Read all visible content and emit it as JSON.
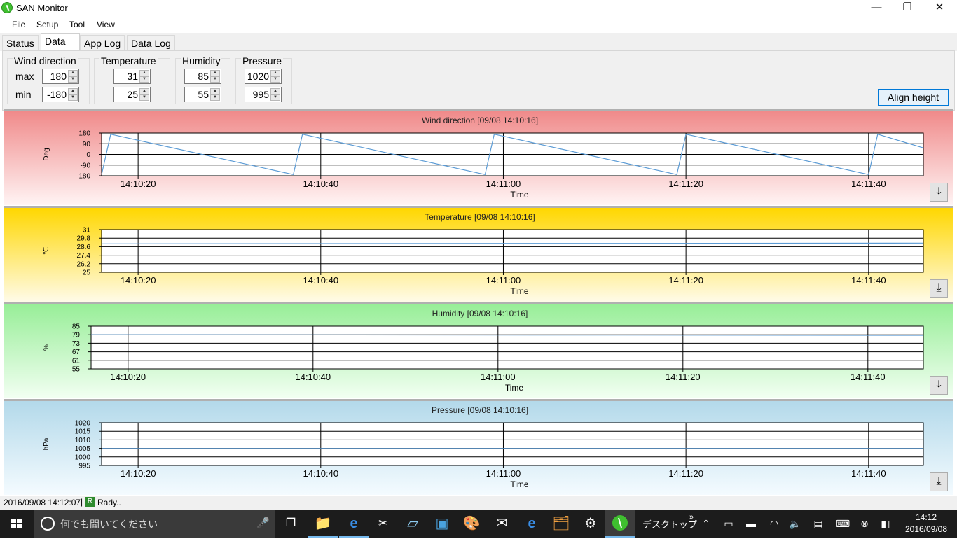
{
  "window": {
    "title": "SAN Monitor",
    "minimize": "—",
    "maximize": "❐",
    "close": "✕"
  },
  "menu": [
    "File",
    "Setup",
    "Tool",
    "View"
  ],
  "tabs": [
    {
      "label": "Status",
      "active": false
    },
    {
      "label": "Data",
      "active": true
    },
    {
      "label": "App Log",
      "active": false
    },
    {
      "label": "Data Log",
      "active": false
    }
  ],
  "controls": {
    "max_label": "max",
    "min_label": "min",
    "groups": [
      {
        "label": "Wind direction",
        "max": "180",
        "min": "-180"
      },
      {
        "label": "Temperature",
        "max": "31",
        "min": "25"
      },
      {
        "label": "Humidity",
        "max": "85",
        "min": "55"
      },
      {
        "label": "Pressure",
        "max": "1020",
        "min": "995"
      }
    ],
    "align_button": "Align height"
  },
  "chart_data": [
    {
      "type": "line",
      "title": "Wind direction [09/08 14:10:16]",
      "xlabel": "Time",
      "ylabel": "Deg",
      "ylim": [
        -180,
        180
      ],
      "y_ticks": [
        "180",
        "90",
        "0",
        "-90",
        "-180"
      ],
      "x_ticks": [
        "14:10:20",
        "14:10:40",
        "14:11:00",
        "14:11:20",
        "14:11:40"
      ],
      "x_range_seconds": [
        "14:10:16",
        "14:11:46"
      ],
      "series": [
        {
          "values_comment_free": true,
          "x": [
            "14:10:16",
            "14:10:17",
            "14:10:37",
            "14:10:38",
            "14:10:58",
            "14:10:59",
            "14:11:19",
            "14:11:20",
            "14:11:40",
            "14:11:41",
            "14:11:46"
          ],
          "values": [
            -170,
            170,
            -170,
            170,
            -170,
            170,
            -170,
            170,
            -170,
            170,
            55
          ]
        }
      ],
      "color": "#5b9bd5",
      "grid": true,
      "background_top": "#f08a8a",
      "background_bottom": "#fff4f4"
    },
    {
      "type": "line",
      "title": "Temperature [09/08 14:10:16]",
      "xlabel": "Time",
      "ylabel": "℃",
      "ylim": [
        25,
        31
      ],
      "y_ticks": [
        "31",
        "29.8",
        "28.6",
        "27.4",
        "26.2",
        "25"
      ],
      "x_ticks": [
        "14:10:20",
        "14:10:40",
        "14:11:00",
        "14:11:20",
        "14:11:40"
      ],
      "x_range_seconds": [
        "14:10:16",
        "14:11:46"
      ],
      "series": [
        {
          "x": [
            "14:10:16",
            "14:11:46"
          ],
          "values": [
            29.0,
            29.1
          ]
        }
      ],
      "color": "#5b9bd5",
      "grid": true,
      "background_top": "#ffd700",
      "background_bottom": "#fffbe8"
    },
    {
      "type": "line",
      "title": "Humidity [09/08 14:10:16]",
      "xlabel": "Time",
      "ylabel": "%",
      "ylim": [
        55,
        85
      ],
      "y_ticks": [
        "85",
        "79",
        "73",
        "67",
        "61",
        "55"
      ],
      "x_ticks": [
        "14:10:20",
        "14:10:40",
        "14:11:00",
        "14:11:20",
        "14:11:40"
      ],
      "x_range_seconds": [
        "14:10:16",
        "14:11:46"
      ],
      "series": [
        {
          "x": [
            "14:10:16",
            "14:11:46"
          ],
          "values": [
            79,
            78.6
          ]
        }
      ],
      "color": "#5b9bd5",
      "grid": true,
      "background_top": "#98ee98",
      "background_bottom": "#f2fff2"
    },
    {
      "type": "line",
      "title": "Pressure [09/08 14:10:16]",
      "xlabel": "Time",
      "ylabel": "hPa",
      "ylim": [
        995,
        1020
      ],
      "y_ticks": [
        "1020",
        "1015",
        "1010",
        "1005",
        "1000",
        "995"
      ],
      "x_ticks": [
        "14:10:20",
        "14:10:40",
        "14:11:00",
        "14:11:20",
        "14:11:40"
      ],
      "x_range_seconds": [
        "14:10:16",
        "14:11:46"
      ],
      "series": [
        {
          "x": [
            "14:10:16",
            "14:11:46"
          ],
          "values": [
            1004.9,
            1004.9
          ]
        }
      ],
      "color": "#5b9bd5",
      "grid": true,
      "background_top": "#b3d9ea",
      "background_bottom": "#f4fbff"
    }
  ],
  "download_icon": "⤓",
  "statusbar": {
    "timestamp": "2016/09/08 14:12:07",
    "separator": "|",
    "indicator": "R",
    "status": "Rady.."
  },
  "taskbar": {
    "search_placeholder": "何でも聞いてください",
    "desktop_label": "デスクトップ",
    "clock_time": "14:12",
    "clock_date": "2016/09/08"
  }
}
